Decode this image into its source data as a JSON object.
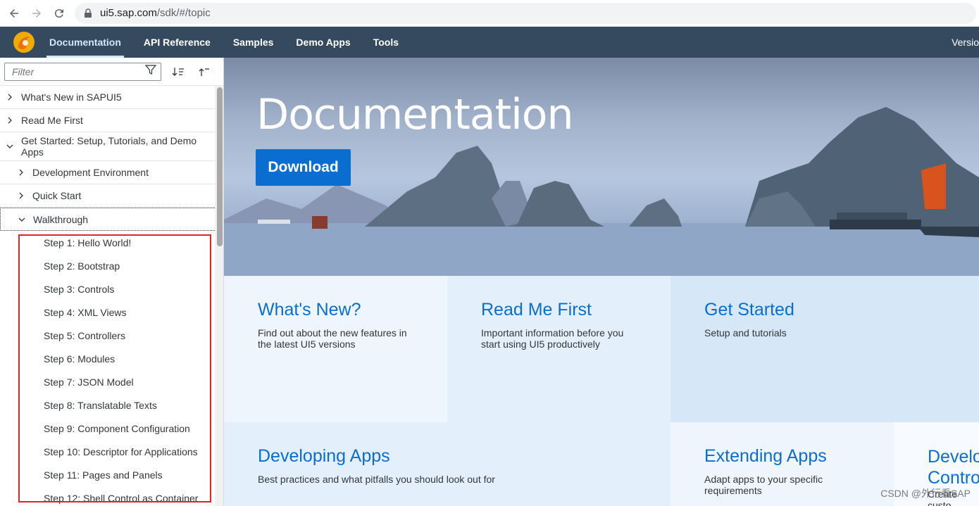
{
  "browser": {
    "url_host": "ui5.sap.com",
    "url_path": "/sdk/#/topic"
  },
  "header": {
    "tabs": [
      {
        "label": "Documentation"
      },
      {
        "label": "API Reference"
      },
      {
        "label": "Samples"
      },
      {
        "label": "Demo Apps"
      },
      {
        "label": "Tools"
      }
    ],
    "version_label": "Versio"
  },
  "sidebar": {
    "filter_placeholder": "Filter",
    "tree": [
      {
        "label": "What's New in SAPUI5"
      },
      {
        "label": "Read Me First"
      },
      {
        "label": "Get Started: Setup, Tutorials, and Demo Apps"
      },
      {
        "label": "Development Environment"
      },
      {
        "label": "Quick Start"
      },
      {
        "label": "Walkthrough"
      }
    ],
    "steps": [
      "Step 1: Hello World!",
      "Step 2: Bootstrap",
      "Step 3: Controls",
      "Step 4: XML Views",
      "Step 5: Controllers",
      "Step 6: Modules",
      "Step 7: JSON Model",
      "Step 8: Translatable Texts",
      "Step 9: Component Configuration",
      "Step 10: Descriptor for Applications",
      "Step 11: Pages and Panels",
      "Step 12: Shell Control as Container"
    ]
  },
  "hero": {
    "title": "Documentation",
    "download_label": "Download"
  },
  "tiles": [
    {
      "title": "What's New?",
      "desc": "Find out about the new features in the latest UI5 versions"
    },
    {
      "title": "Read Me First",
      "desc": "Important information before you start using UI5 productively"
    },
    {
      "title": "Get Started",
      "desc": "Setup and tutorials"
    },
    {
      "title": "Developing Apps",
      "desc": "Best practices and what pitfalls you should look out for"
    },
    {
      "title": "Extending Apps",
      "desc": "Adapt apps to your specific requirements"
    },
    {
      "title": "Develo Contro",
      "desc": "Create custo"
    }
  ],
  "watermark": "CSDN @外行看SAP"
}
